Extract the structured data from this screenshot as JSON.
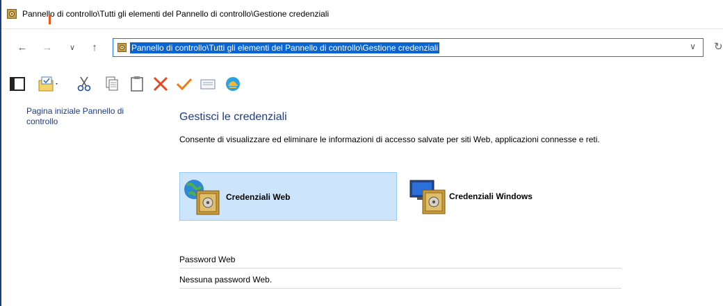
{
  "window": {
    "title": "Pannello di controllo\\Tutti gli elementi del Pannello di controllo\\Gestione credenziali"
  },
  "nav": {
    "address": "Pannello di controllo\\Tutti gli elementi del Pannello di controllo\\Gestione credenziali",
    "back_icon": "←",
    "forward_icon": "→",
    "recent_icon": "∨",
    "up_icon": "↑",
    "dropdown_icon": "∨",
    "refresh_icon": "↻"
  },
  "sidebar": {
    "home_link": "Pagina iniziale Pannello di controllo"
  },
  "main": {
    "heading": "Gestisci le credenziali",
    "description": "Consente di visualizzare ed eliminare le informazioni di accesso salvate per siti Web, applicazioni connesse e reti.",
    "tiles": [
      {
        "label": "Credenziali Web",
        "selected": true
      },
      {
        "label": "Credenziali Windows",
        "selected": false
      }
    ],
    "list": [
      {
        "text": "Password Web"
      },
      {
        "text": "Nessuna password Web."
      }
    ]
  },
  "colors": {
    "link": "#1f3a87",
    "selection": "#0a64d2",
    "tile_selected": "#cce5fb"
  }
}
